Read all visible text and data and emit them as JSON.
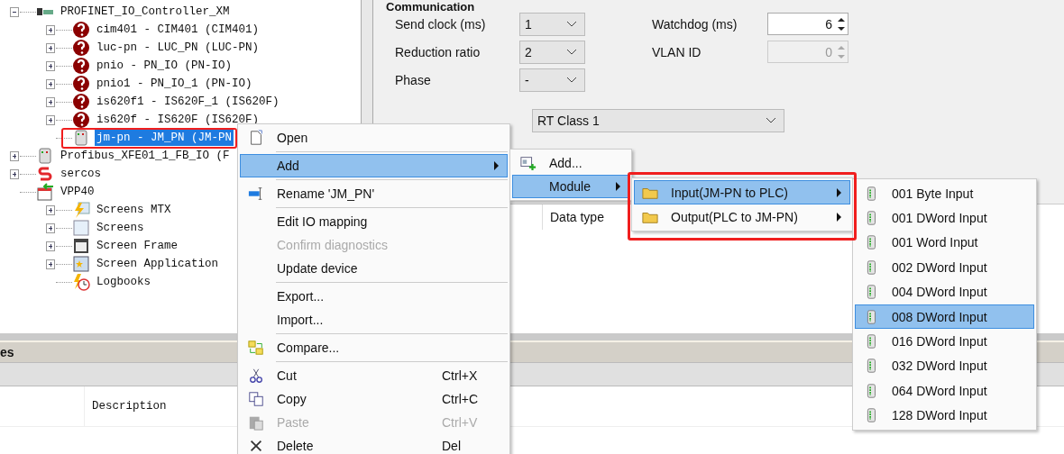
{
  "tree": [
    {
      "label": "PROFINET_IO_Controller_XM",
      "kind": "controller",
      "expanded": true,
      "selected": false,
      "children": [
        {
          "label": "cim401 - CIM401 (CIM401)",
          "kind": "error",
          "expanded": false,
          "selected": false
        },
        {
          "label": "luc-pn - LUC_PN (LUC-PN)",
          "kind": "error",
          "expanded": false,
          "selected": false
        },
        {
          "label": "pnio - PN_IO (PN-IO)",
          "kind": "error",
          "expanded": false,
          "selected": false
        },
        {
          "label": "pnio1 - PN_IO_1 (PN-IO)",
          "kind": "error",
          "expanded": false,
          "selected": false
        },
        {
          "label": "is620f1 - IS620F_1 (IS620F)",
          "kind": "error",
          "expanded": false,
          "selected": false
        },
        {
          "label": "is620f - IS620F (IS620F)",
          "kind": "error",
          "expanded": false,
          "selected": false
        },
        {
          "label": "jm-pn - JM_PN (JM-PN",
          "kind": "module",
          "selected": true
        }
      ]
    },
    {
      "label": "Profibus_XFE01_1_FB_IO (F",
      "kind": "module",
      "expanded": false,
      "selected": false
    },
    {
      "label": "sercos",
      "kind": "sercos",
      "expanded": false,
      "selected": false
    },
    {
      "label": "VPP40",
      "kind": "hmi",
      "selected": false,
      "children": [
        {
          "label": "Screens MTX",
          "kind": "bolt",
          "expanded": false,
          "selected": false
        },
        {
          "label": "Screens",
          "kind": "screen",
          "expanded": false,
          "selected": false
        },
        {
          "label": "Screen Frame",
          "kind": "frame",
          "expanded": false,
          "selected": false
        },
        {
          "label": "Screen Application",
          "kind": "app",
          "expanded": false,
          "selected": false
        },
        {
          "label": "Logbooks",
          "kind": "log",
          "selected": false
        }
      ]
    }
  ],
  "settings": {
    "section": "Communication",
    "left_fields": [
      {
        "label": "Send clock (ms)",
        "value": "1"
      },
      {
        "label": "Reduction ratio",
        "value": "2"
      },
      {
        "label": "Phase",
        "value": "-"
      }
    ],
    "right_fields": [
      {
        "label": "Watchdog (ms)",
        "value": "6",
        "disabled": false
      },
      {
        "label": "VLAN ID",
        "value": "0",
        "disabled": true
      }
    ],
    "rt_class": {
      "value": "RT Class 1"
    }
  },
  "io_table": {
    "columns": [
      "Data type"
    ]
  },
  "bottom_panel": {
    "title": "es",
    "columns": [
      "Description"
    ]
  },
  "context_menu": [
    {
      "kind": "open",
      "label": "Open",
      "disabled": false,
      "selected": false,
      "submenu": false
    },
    {
      "kind": "separator"
    },
    {
      "kind": "plain",
      "label": "Add",
      "disabled": false,
      "selected": true,
      "submenu": true
    },
    {
      "kind": "separator"
    },
    {
      "kind": "rename",
      "label": "Rename 'JM_PN'",
      "disabled": false,
      "selected": false,
      "submenu": false
    },
    {
      "kind": "separator"
    },
    {
      "kind": "plain",
      "label": "Edit IO mapping",
      "disabled": false,
      "selected": false,
      "submenu": false
    },
    {
      "kind": "plain",
      "label": "Confirm diagnostics",
      "disabled": true,
      "selected": false,
      "submenu": false
    },
    {
      "kind": "plain",
      "label": "Update device",
      "disabled": false,
      "selected": false,
      "submenu": false
    },
    {
      "kind": "separator"
    },
    {
      "kind": "plain",
      "label": "Export...",
      "disabled": false,
      "selected": false,
      "submenu": false
    },
    {
      "kind": "plain",
      "label": "Import...",
      "disabled": false,
      "selected": false,
      "submenu": false
    },
    {
      "kind": "separator"
    },
    {
      "kind": "compare",
      "label": "Compare...",
      "disabled": false,
      "selected": false,
      "submenu": false
    },
    {
      "kind": "separator"
    },
    {
      "kind": "cut",
      "label": "Cut",
      "shortcut": "Ctrl+X",
      "disabled": false,
      "selected": false,
      "submenu": false
    },
    {
      "kind": "copy",
      "label": "Copy",
      "shortcut": "Ctrl+C",
      "disabled": false,
      "selected": false,
      "submenu": false
    },
    {
      "kind": "paste",
      "label": "Paste",
      "shortcut": "Ctrl+V",
      "disabled": true,
      "selected": false,
      "submenu": false
    },
    {
      "kind": "delete",
      "label": "Delete",
      "shortcut": "Del",
      "disabled": false,
      "selected": false,
      "submenu": false
    }
  ],
  "add_menu": [
    {
      "kind": "add",
      "label": "Add...",
      "selected": false,
      "submenu": false
    },
    {
      "kind": "plain",
      "label": "Module",
      "selected": true,
      "submenu": true
    }
  ],
  "module_menu": [
    {
      "label": "Input(JM-PN to PLC)",
      "selected": true
    },
    {
      "label": "Output(PLC to JM-PN)",
      "selected": false
    }
  ],
  "input_menu": [
    {
      "label": "001 Byte Input",
      "selected": false
    },
    {
      "label": "001 DWord Input",
      "selected": false
    },
    {
      "label": "001 Word Input",
      "selected": false
    },
    {
      "label": "002 DWord Input",
      "selected": false
    },
    {
      "label": "004 DWord Input",
      "selected": false
    },
    {
      "label": "008 DWord Input",
      "selected": true
    },
    {
      "label": "016 DWord Input",
      "selected": false
    },
    {
      "label": "032 DWord Input",
      "selected": false
    },
    {
      "label": "064 DWord Input",
      "selected": false
    },
    {
      "label": "128 DWord Input",
      "selected": false
    }
  ]
}
